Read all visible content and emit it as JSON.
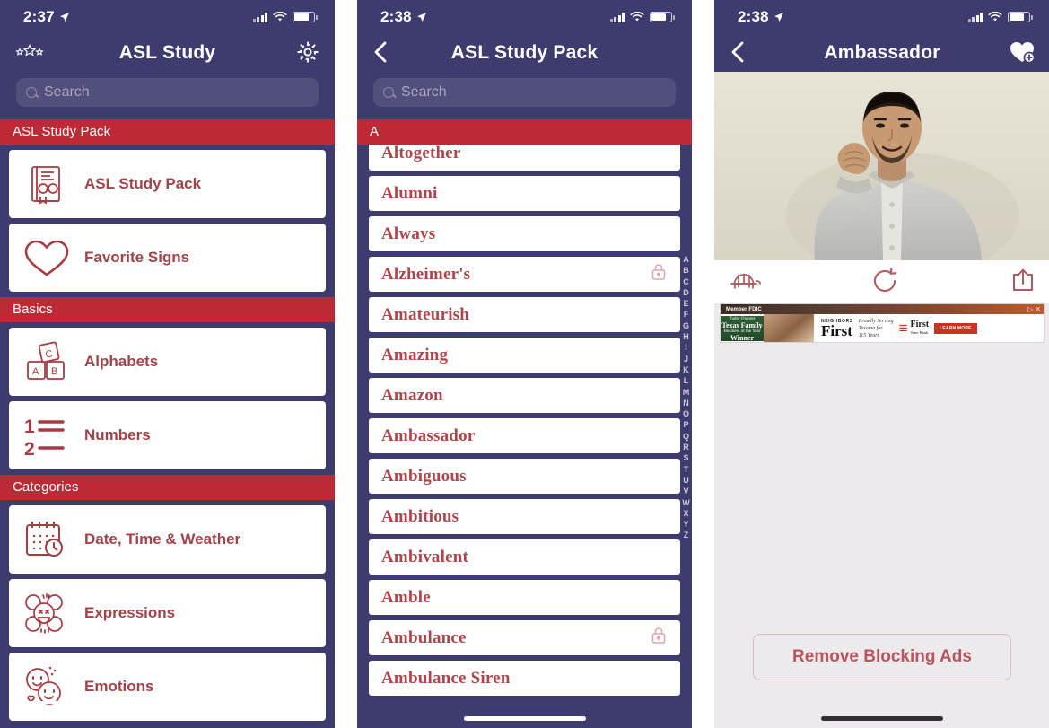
{
  "colors": {
    "navy": "#3e3c6e",
    "red_header": "#bd2a35",
    "card_text": "#a34349",
    "word_text": "#b0444a",
    "white": "#ffffff",
    "right_bg": "#eceaec",
    "remove_btn_text": "#b9555c"
  },
  "screen1": {
    "status": {
      "time": "2:37",
      "location_icon": "location-arrow-icon",
      "signal": "cellular-bars-icon",
      "wifi": "wifi-icon",
      "battery": "battery-icon"
    },
    "nav": {
      "left_icon": "three-stars-icon",
      "title": "ASL Study",
      "right_icon": "gear-icon"
    },
    "search": {
      "placeholder": "Search",
      "icon": "search-icon"
    },
    "sections": [
      {
        "header": "ASL Study Pack",
        "items": [
          {
            "label": "ASL Study Pack",
            "icon": "book-study-pack-icon"
          },
          {
            "label": "Favorite Signs",
            "icon": "heart-icon"
          }
        ]
      },
      {
        "header": "Basics",
        "items": [
          {
            "label": "Alphabets",
            "icon": "alphabet-blocks-icon"
          },
          {
            "label": "Numbers",
            "icon": "numbers-list-icon"
          }
        ]
      },
      {
        "header": "Categories",
        "items": [
          {
            "label": "Date, Time & Weather",
            "icon": "calendar-clock-icon"
          },
          {
            "label": "Expressions",
            "icon": "expressions-faces-icon"
          },
          {
            "label": "Emotions",
            "icon": "emotions-faces-icon"
          }
        ]
      }
    ]
  },
  "screen2": {
    "status": {
      "time": "2:38"
    },
    "nav": {
      "back_icon": "chevron-left-icon",
      "title": "ASL Study Pack"
    },
    "search": {
      "placeholder": "Search",
      "icon": "search-icon"
    },
    "section_header": "A",
    "words": [
      {
        "label": "Altogether",
        "locked": false
      },
      {
        "label": "Alumni",
        "locked": false
      },
      {
        "label": "Always",
        "locked": false
      },
      {
        "label": "Alzheimer's",
        "locked": true
      },
      {
        "label": "Amateurish",
        "locked": false
      },
      {
        "label": "Amazing",
        "locked": false
      },
      {
        "label": "Amazon",
        "locked": false
      },
      {
        "label": "Ambassador",
        "locked": false
      },
      {
        "label": "Ambiguous",
        "locked": false
      },
      {
        "label": "Ambitious",
        "locked": false
      },
      {
        "label": "Ambivalent",
        "locked": false
      },
      {
        "label": "Amble",
        "locked": false
      },
      {
        "label": "Ambulance",
        "locked": true
      },
      {
        "label": "Ambulance Siren",
        "locked": false
      }
    ],
    "alpha_index": [
      "A",
      "B",
      "C",
      "D",
      "E",
      "F",
      "G",
      "H",
      "I",
      "J",
      "K",
      "L",
      "M",
      "N",
      "O",
      "P",
      "Q",
      "R",
      "S",
      "T",
      "U",
      "V",
      "W",
      "X",
      "Y",
      "Z"
    ]
  },
  "screen3": {
    "status": {
      "time": "2:38"
    },
    "nav": {
      "back_icon": "chevron-left-icon",
      "title": "Ambassador",
      "right_icon": "heart-plus-icon"
    },
    "video": {
      "description": "sign language video of man making a fist gesture",
      "alt": "ASL sign demonstration"
    },
    "controls": {
      "slow_motion": "turtle-slow-icon",
      "replay": "replay-icon",
      "share": "share-icon"
    },
    "ad": {
      "fdic": "Member FDIC",
      "green_top": "Tudor Owners",
      "green_mid": "Texas Family",
      "green_sub": "Business of the Year",
      "green_winner": "Winner",
      "neighbors": "NEIGHBORS",
      "first_big": "First",
      "serving_line1": "Proudly Serving",
      "serving_line2": "Texoma for",
      "serving_line3": "115 Years",
      "logo_first": "First",
      "logo_sub": "State Bank",
      "learn_more": "LEARN MORE",
      "close_icon": "ad-close-icon",
      "info_icon": "ad-choices-icon"
    },
    "remove_button": "Remove Blocking Ads"
  }
}
